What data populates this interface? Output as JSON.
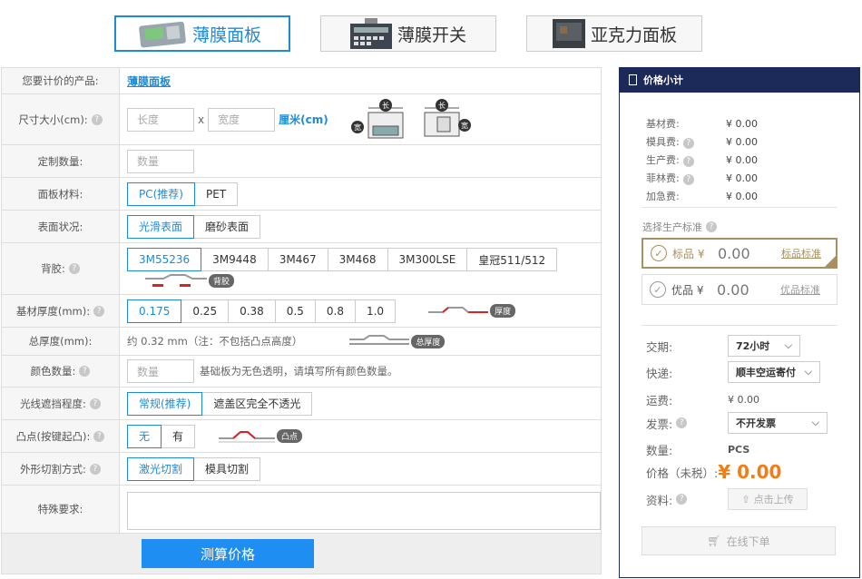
{
  "tabs": [
    {
      "label": "薄膜面板",
      "active": true
    },
    {
      "label": "薄膜开关",
      "active": false
    },
    {
      "label": "亚克力面板",
      "active": false
    }
  ],
  "form": {
    "product": {
      "label": "您要计价的产品:",
      "value": "薄膜面板"
    },
    "size": {
      "label": "尺寸大小(cm):",
      "length_placeholder": "长度",
      "times": "x",
      "width_placeholder": "宽度",
      "unit": "厘米(cm)",
      "diagram_long": "长",
      "diagram_wide": "宽"
    },
    "qty": {
      "label": "定制数量:",
      "placeholder": "数量"
    },
    "material": {
      "label": "面板材料:",
      "options": [
        "PC(推荐)",
        "PET"
      ]
    },
    "surface": {
      "label": "表面状况:",
      "options": [
        "光滑表面",
        "磨砂表面"
      ]
    },
    "adhesive": {
      "label": "背胶:",
      "options": [
        "3M55236",
        "3M9448",
        "3M467",
        "3M468",
        "3M300LSE",
        "皇冠511/512"
      ],
      "diagram_tag": "背胶"
    },
    "thickness": {
      "label": "基材厚度(mm):",
      "options": [
        "0.175",
        "0.25",
        "0.38",
        "0.5",
        "0.8",
        "1.0"
      ],
      "diagram_tag": "厚度"
    },
    "total": {
      "label": "总厚度(mm):",
      "value": "约 0.32 mm（注：不包括凸点高度）",
      "diagram_tag": "总厚度"
    },
    "colors": {
      "label": "颜色数量:",
      "placeholder": "数量",
      "note": "基础板为无色透明，请填写所有颜色数量。"
    },
    "shading": {
      "label": "光线遮挡程度:",
      "options": [
        "常规(推荐)",
        "遮盖区完全不透光"
      ]
    },
    "bump": {
      "label": "凸点(按键起凸):",
      "options": [
        "无",
        "有"
      ],
      "diagram_tag": "凸点"
    },
    "cutting": {
      "label": "外形切割方式:",
      "options": [
        "激光切割",
        "模具切割"
      ]
    },
    "special": {
      "label": "特殊要求:"
    },
    "calc_button": "测算价格"
  },
  "sidebar": {
    "title": "价格小计",
    "fees": [
      {
        "name": "基材费:",
        "amount": "¥ 0.00",
        "help": false
      },
      {
        "name": "模具费:",
        "amount": "¥ 0.00",
        "help": true
      },
      {
        "name": "生产费:",
        "amount": "¥ 0.00",
        "help": true
      },
      {
        "name": "菲林费:",
        "amount": "¥ 0.00",
        "help": true
      },
      {
        "name": "加急费:",
        "amount": "¥ 0.00",
        "help": false
      }
    ],
    "standard_title": "选择生产标准",
    "standards": [
      {
        "name": "标品 ¥",
        "value": "0.00",
        "link": "标品标准",
        "selected": true
      },
      {
        "name": "优品 ¥",
        "value": "0.00",
        "link": "优品标准",
        "selected": false
      }
    ],
    "delivery": {
      "label": "交期:",
      "value": "72小时"
    },
    "express": {
      "label": "快递:",
      "value": "顺丰空运寄付"
    },
    "shipping": {
      "label": "运费:",
      "value": "¥ 0.00"
    },
    "invoice": {
      "label": "发票:",
      "value": "不开发票"
    },
    "quantity": {
      "label": "数量:",
      "value": "PCS"
    },
    "price": {
      "label": "价格（未税）:",
      "value": "¥ 0.00"
    },
    "files": {
      "label": "资料:",
      "upload": "点击上传"
    },
    "order_button": "在线下单"
  },
  "colors": {
    "accent": "#1d8bd8",
    "navy": "#1c2a59",
    "gold": "#a89060",
    "price": "#f27c15",
    "button": "#1e8ef2"
  }
}
